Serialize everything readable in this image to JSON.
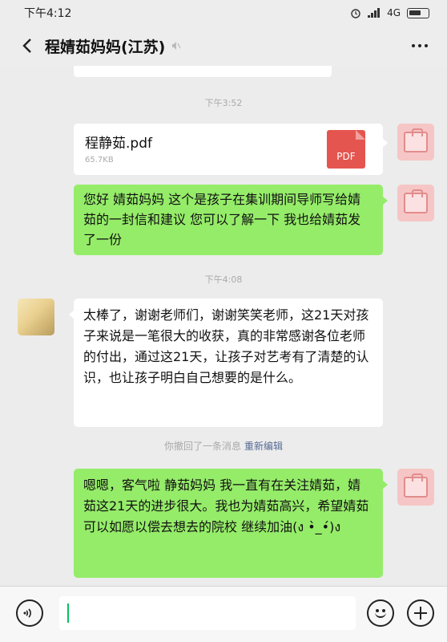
{
  "status_bar": {
    "time": "下午4:12",
    "network": "4G"
  },
  "header": {
    "title": "程婧茹妈妈(江苏)"
  },
  "messages": {
    "ts1": "下午3:52",
    "file": {
      "name": "程静茹.pdf",
      "size": "65.7KB",
      "badge": "PDF"
    },
    "msg1": "您好 婧茹妈妈 这个是孩子在集训期间导师写给婧茹的一封信和建议 您可以了解一下 我也给婧茹发了一份",
    "ts2": "下午4:08",
    "msg2": "太棒了，谢谢老师们，谢谢笑笑老师，这21天对孩子来说是一笔很大的收获，真的非常感谢各位老师的付出，通过这21天，让孩子对艺考有了清楚的认识，也让孩子明白自己想要的是什么。",
    "recall_notice": "你撤回了一条消息",
    "recall_edit": "重新编辑",
    "msg3": "嗯嗯，客气啦 静茹妈妈 我一直有在关注婧茹，婧茹这21天的进步很大。我也为婧茹高兴，希望婧茹可以如愿以偿去想去的院校 继续加油(ง •̀_•́)ง"
  },
  "colors": {
    "self_bubble": "#95ec69",
    "other_bubble": "#ffffff",
    "background": "#ececec",
    "pdf_red": "#e5554f"
  },
  "icons": [
    "back-icon",
    "mute-icon",
    "more-icon",
    "voice-icon",
    "emoji-icon",
    "plus-icon",
    "pdf-icon"
  ]
}
